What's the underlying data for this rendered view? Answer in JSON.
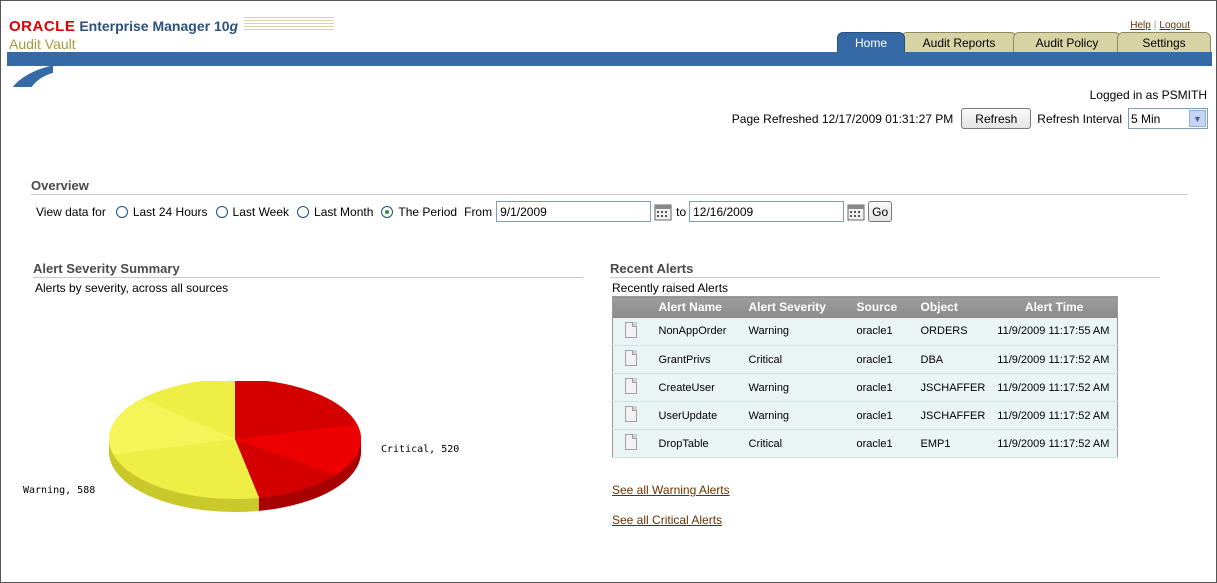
{
  "branding": {
    "oracle": "ORACLE",
    "em": "Enterprise Manager 10",
    "em_version": "g",
    "product": "Audit Vault"
  },
  "global_links": {
    "help": "Help",
    "logout": "Logout"
  },
  "tabs": [
    {
      "label": "Home",
      "active": true
    },
    {
      "label": "Audit Reports",
      "active": false
    },
    {
      "label": "Audit Policy",
      "active": false
    },
    {
      "label": "Settings",
      "active": false
    }
  ],
  "logged_in": "Logged in as PSMITH",
  "refresh": {
    "page_refreshed": "Page Refreshed 12/17/2009 01:31:27 PM",
    "button": "Refresh",
    "interval_label": "Refresh Interval",
    "interval_value": "5 Min"
  },
  "overview": {
    "title": "Overview",
    "view_data_for": "View data for",
    "options": [
      "Last 24 Hours",
      "Last Week",
      "Last Month",
      "The Period"
    ],
    "selected": "The Period",
    "from_label": "From",
    "from_value": "9/1/2009",
    "to_label": "to",
    "to_value": "12/16/2009",
    "go": "Go"
  },
  "summary": {
    "title": "Alert Severity Summary",
    "subtitle": "Alerts by severity, across all sources"
  },
  "chart_data": {
    "type": "pie",
    "title": "",
    "categories": [
      "Critical",
      "Warning"
    ],
    "values": [
      520,
      588
    ],
    "labels": [
      "Critical, 520",
      "Warning, 588"
    ],
    "colors": [
      "#d40000",
      "#eeee44"
    ]
  },
  "alerts": {
    "title": "Recent Alerts",
    "subtitle": "Recently raised Alerts",
    "columns": [
      "Alert Name",
      "Alert Severity",
      "Source",
      "Object",
      "Alert Time"
    ],
    "rows": [
      [
        "NonAppOrder",
        "Warning",
        "oracle1",
        "ORDERS",
        "11/9/2009 11:17:55 AM"
      ],
      [
        "GrantPrivs",
        "Critical",
        "oracle1",
        "DBA",
        "11/9/2009 11:17:52 AM"
      ],
      [
        "CreateUser",
        "Warning",
        "oracle1",
        "JSCHAFFER",
        "11/9/2009 11:17:52 AM"
      ],
      [
        "UserUpdate",
        "Warning",
        "oracle1",
        "JSCHAFFER",
        "11/9/2009 11:17:52 AM"
      ],
      [
        "DropTable",
        "Critical",
        "oracle1",
        "EMP1",
        "11/9/2009 11:17:52 AM"
      ]
    ],
    "see_warning": "See all Warning Alerts",
    "see_critical": "See all Critical Alerts"
  }
}
